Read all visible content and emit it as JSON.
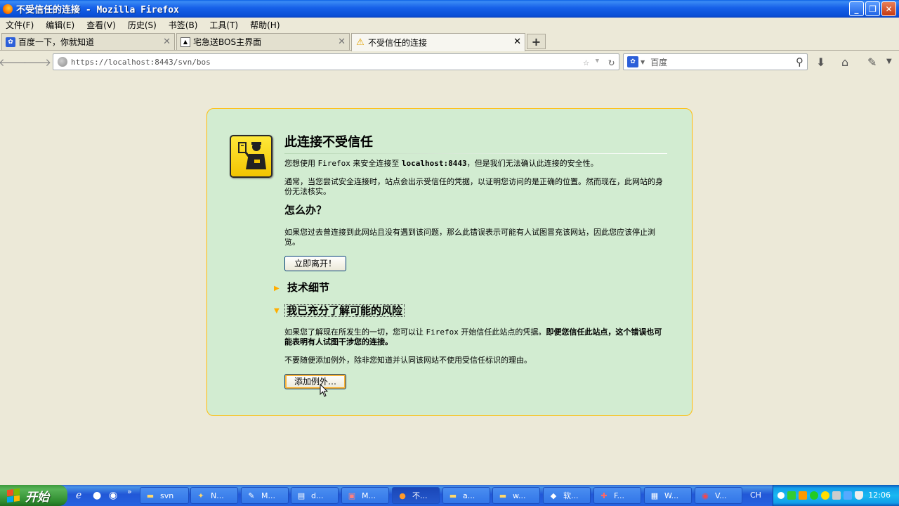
{
  "window": {
    "title": "不受信任的连接 - Mozilla Firefox",
    "minimize": "_",
    "maximize": "❐",
    "close": "✕"
  },
  "menu": [
    "文件(F)",
    "编辑(E)",
    "查看(V)",
    "历史(S)",
    "书签(B)",
    "工具(T)",
    "帮助(H)"
  ],
  "tabs": [
    {
      "label": "百度一下，你就知道",
      "icon": "baidu-paw-icon"
    },
    {
      "label": "宅急送BOS主界面",
      "icon": "image-icon"
    },
    {
      "label": "不受信任的连接",
      "icon": "warning-icon",
      "active": true
    }
  ],
  "new_tab": "+",
  "nav": {
    "url_host": "https://localhost",
    "url_rest": ":8443/svn/bos",
    "search_placeholder": "百度"
  },
  "error": {
    "title": "此连接不受信任",
    "p1_pre": "您想使用 ",
    "p1_app": "Firefox",
    "p1_mid": " 来安全连接至 ",
    "p1_host": "localhost:8443",
    "p1_post": "，但是我们无法确认此连接的安全性。",
    "p2": "通常，当您尝试安全连接时，站点会出示受信任的凭据，以证明您访问的是正确的位置。然而现在，此网站的身份无法核实。",
    "h_what": "怎么办？",
    "p3": "如果您过去曾连接到此网站且没有遇到该问题，那么此错误表示可能有人试图冒充该网站，因此您应该停止浏览。",
    "leave_button": "立即离开！",
    "tech_details": "技术细节",
    "understand_risks": "我已充分了解可能的风险",
    "p4_pre": "如果您了解现在所发生的一切，您可以让 ",
    "p4_app": "Firefox",
    "p4_mid": " 开始信任此站点的凭据。",
    "p4_bold": "即便您信任此站点，这个错误也可能表明有人试图干涉您的连接。",
    "p5": "不要随便添加例外，除非您知道并认同该网站不使用受信任标识的理由。",
    "add_exception_button": "添加例外…"
  },
  "taskbar": {
    "start": "开始",
    "items": [
      {
        "label": "svn",
        "icon": "folder-icon"
      },
      {
        "label": "N...",
        "icon": "app-icon"
      },
      {
        "label": "M...",
        "icon": "eclipse-icon"
      },
      {
        "label": "d...",
        "icon": "document-icon"
      },
      {
        "label": "M...",
        "icon": "app-icon"
      },
      {
        "label": "不...",
        "icon": "firefox-icon",
        "active": true
      },
      {
        "label": "a...",
        "icon": "folder-icon"
      },
      {
        "label": "w...",
        "icon": "folder-icon"
      },
      {
        "label": "软...",
        "icon": "app-icon"
      },
      {
        "label": "F...",
        "icon": "app-icon"
      },
      {
        "label": "W...",
        "icon": "app-icon"
      },
      {
        "label": "V...",
        "icon": "chrome-icon"
      }
    ],
    "lang": "CH",
    "clock": "12:06"
  },
  "colors": {
    "errbox_bg": "#d2ecd1",
    "errbox_border": "#ffbd09",
    "accent_triangle": "#ffad00"
  }
}
